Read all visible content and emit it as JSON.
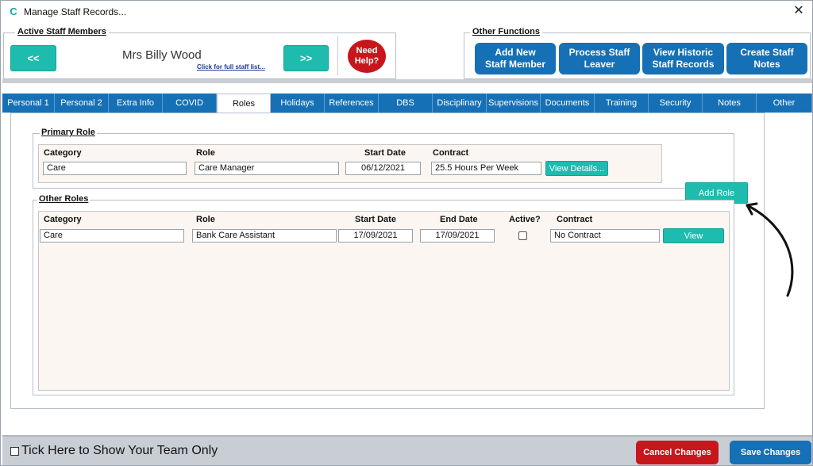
{
  "window": {
    "title": "Manage Staff Records...",
    "close_label": "✕"
  },
  "active_staff": {
    "title": "Active Staff Members",
    "prev_label": "<<",
    "next_label": ">>",
    "staff_name": "Mrs Billy Wood",
    "full_list_link": "Click for full staff list...",
    "help_line1": "Need",
    "help_line2": "Help?"
  },
  "other_functions": {
    "title": "Other Functions",
    "buttons": [
      {
        "line1": "Add New",
        "line2": "Staff Member"
      },
      {
        "line1": "Process Staff",
        "line2": "Leaver"
      },
      {
        "line1": "View Historic",
        "line2": "Staff Records"
      },
      {
        "line1": "Create Staff",
        "line2": "Notes"
      }
    ]
  },
  "tabs": [
    {
      "label": "Personal 1"
    },
    {
      "label": "Personal 2"
    },
    {
      "label": "Extra Info"
    },
    {
      "label": "COVID"
    },
    {
      "label": "Roles"
    },
    {
      "label": "Holidays"
    },
    {
      "label": "References"
    },
    {
      "label": "DBS"
    },
    {
      "label": "Disciplinary"
    },
    {
      "label": "Supervisions"
    },
    {
      "label": "Documents"
    },
    {
      "label": "Training"
    },
    {
      "label": "Security"
    },
    {
      "label": "Notes"
    },
    {
      "label": "Other"
    }
  ],
  "primary_role": {
    "title": "Primary Role",
    "headers": {
      "category": "Category",
      "role": "Role",
      "start_date": "Start Date",
      "contract": "Contract"
    },
    "values": {
      "category": "Care",
      "role": "Care Manager",
      "start_date": "06/12/2021",
      "contract": "25.5 Hours Per Week"
    },
    "view_details_label": "View Details..."
  },
  "add_role_label": "Add Role",
  "other_roles": {
    "title": "Other Roles",
    "headers": {
      "category": "Category",
      "role": "Role",
      "start_date": "Start Date",
      "end_date": "End Date",
      "active": "Active?",
      "contract": "Contract"
    },
    "rows": [
      {
        "category": "Care",
        "role": "Bank Care Assistant",
        "start_date": "17/09/2021",
        "end_date": "17/09/2021",
        "active": false,
        "contract": "No Contract",
        "view_label": "View"
      }
    ]
  },
  "footer": {
    "team_only_label": "Tick Here to Show Your Team Only",
    "cancel_label": "Cancel Changes",
    "save_label": "Save Changes"
  }
}
